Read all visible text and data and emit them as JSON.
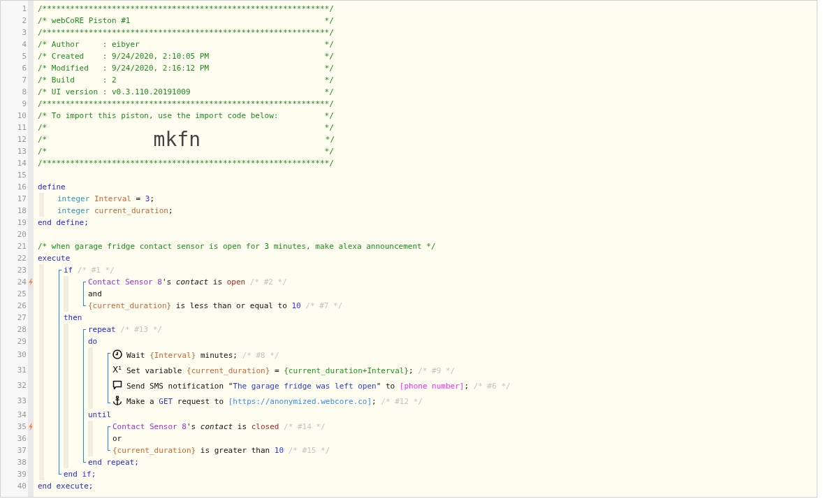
{
  "editor": {
    "lines": [
      {
        "kind": "line",
        "number": "1",
        "trigger": false,
        "tokens": [
          {
            "kind": "comment",
            "text": "/**************************************************************/"
          }
        ]
      },
      {
        "kind": "line",
        "number": "2",
        "trigger": false,
        "tokens": [
          {
            "kind": "comment",
            "text": "/* webCoRE Piston #1                                          */"
          }
        ]
      },
      {
        "kind": "line",
        "number": "3",
        "trigger": false,
        "tokens": [
          {
            "kind": "comment",
            "text": "/**************************************************************/"
          }
        ]
      },
      {
        "kind": "line",
        "number": "4",
        "trigger": false,
        "tokens": [
          {
            "kind": "comment",
            "text": "/* Author     : eibyer                                        */"
          }
        ]
      },
      {
        "kind": "line",
        "number": "5",
        "trigger": false,
        "tokens": [
          {
            "kind": "comment",
            "text": "/* Created    : 9/24/2020, 2:10:05 PM                         */"
          }
        ]
      },
      {
        "kind": "line",
        "number": "6",
        "trigger": false,
        "tokens": [
          {
            "kind": "comment",
            "text": "/* Modified   : 9/24/2020, 2:16:12 PM                         */"
          }
        ]
      },
      {
        "kind": "line",
        "number": "7",
        "trigger": false,
        "tokens": [
          {
            "kind": "comment",
            "text": "/* Build      : 2                                             */"
          }
        ]
      },
      {
        "kind": "line",
        "number": "8",
        "trigger": false,
        "tokens": [
          {
            "kind": "comment",
            "text": "/* UI version : v0.3.110.20191009                             */"
          }
        ]
      },
      {
        "kind": "line",
        "number": "9",
        "trigger": false,
        "tokens": [
          {
            "kind": "comment",
            "text": "/**************************************************************/"
          }
        ]
      },
      {
        "kind": "line",
        "number": "10",
        "trigger": false,
        "tokens": [
          {
            "kind": "comment",
            "text": "/* To import this piston, use the import code below:          */"
          }
        ]
      },
      {
        "kind": "line",
        "number": "11",
        "trigger": false,
        "tokens": [
          {
            "kind": "comment",
            "text": "/*                                                            */"
          }
        ]
      },
      {
        "kind": "line",
        "number": "12",
        "trigger": false,
        "tokens": [
          {
            "kind": "comment",
            "text": "/*                       "
          },
          {
            "kind": "import_code",
            "text": "mkfn"
          },
          {
            "kind": "comment",
            "text": "                           */"
          }
        ]
      },
      {
        "kind": "line",
        "number": "13",
        "trigger": false,
        "tokens": [
          {
            "kind": "comment",
            "text": "/*                                                            */"
          }
        ]
      },
      {
        "kind": "line",
        "number": "14",
        "trigger": false,
        "tokens": [
          {
            "kind": "comment",
            "text": "/**************************************************************/"
          }
        ]
      },
      {
        "kind": "line",
        "number": "15",
        "trigger": false
      },
      {
        "kind": "line",
        "number": "16",
        "trigger": false,
        "tokens": [
          {
            "kind": "keyword",
            "text": "define"
          }
        ]
      },
      {
        "kind": "block",
        "bracket": false,
        "children": [
          {
            "kind": "line",
            "number": "17",
            "trigger": false,
            "tokens": [
              {
                "kind": "type",
                "text": "integer"
              },
              {
                "kind": "variable",
                "text": " Interval"
              },
              {
                "kind": "plain",
                "text": " = "
              },
              {
                "kind": "number",
                "text": "3"
              },
              {
                "kind": "plain",
                "text": ";"
              }
            ]
          },
          {
            "kind": "line",
            "number": "18",
            "trigger": false,
            "tokens": [
              {
                "kind": "type",
                "text": "integer"
              },
              {
                "kind": "variable",
                "text": " current_duration"
              },
              {
                "kind": "plain",
                "text": ";"
              }
            ]
          }
        ]
      },
      {
        "kind": "line",
        "number": "19",
        "trigger": false,
        "tokens": [
          {
            "kind": "keyword",
            "text": "end define;"
          }
        ]
      },
      {
        "kind": "line",
        "number": "20",
        "trigger": false
      },
      {
        "kind": "line",
        "number": "21",
        "trigger": false,
        "tokens": [
          {
            "kind": "comment",
            "text": "/* when garage fridge contact sensor is open for 3 minutes, make alexa announcement */"
          }
        ]
      },
      {
        "kind": "line",
        "number": "22",
        "trigger": false,
        "tokens": [
          {
            "kind": "keyword",
            "text": "execute"
          }
        ]
      },
      {
        "kind": "block",
        "bracket": true,
        "children": [
          {
            "kind": "line",
            "number": "23",
            "trigger": false,
            "tokens": [
              {
                "kind": "keyword",
                "text": "if"
              },
              {
                "kind": "note",
                "text": " /* #1 */"
              }
            ]
          },
          {
            "kind": "block",
            "bracket": true,
            "children": [
              {
                "kind": "line",
                "number": "24",
                "trigger": true,
                "tokens": [
                  {
                    "kind": "device",
                    "text": "Contact Sensor 8"
                  },
                  {
                    "kind": "plain",
                    "text": "'s "
                  },
                  {
                    "kind": "attribute",
                    "text": "contact"
                  },
                  {
                    "kind": "plain",
                    "text": " is "
                  },
                  {
                    "kind": "value",
                    "text": "open"
                  },
                  {
                    "kind": "note",
                    "text": " /* #2 */"
                  }
                ]
              },
              {
                "kind": "line",
                "number": "25",
                "trigger": false,
                "tokens": [
                  {
                    "kind": "plain",
                    "text": "and"
                  }
                ]
              },
              {
                "kind": "line",
                "number": "26",
                "trigger": false,
                "tokens": [
                  {
                    "kind": "variable",
                    "text": "{current_duration}"
                  },
                  {
                    "kind": "plain",
                    "text": " is less than or equal to "
                  },
                  {
                    "kind": "number",
                    "text": "10"
                  },
                  {
                    "kind": "note",
                    "text": " /* #7 */"
                  }
                ]
              }
            ]
          },
          {
            "kind": "line",
            "number": "27",
            "trigger": false,
            "tokens": [
              {
                "kind": "keyword",
                "text": "then"
              }
            ]
          },
          {
            "kind": "block",
            "bracket": true,
            "children": [
              {
                "kind": "line",
                "number": "28",
                "trigger": false,
                "tokens": [
                  {
                    "kind": "keyword",
                    "text": "repeat"
                  },
                  {
                    "kind": "note",
                    "text": " /* #13 */"
                  }
                ]
              },
              {
                "kind": "line",
                "number": "29",
                "trigger": false,
                "tokens": [
                  {
                    "kind": "keyword",
                    "text": "do"
                  }
                ]
              },
              {
                "kind": "block",
                "bracket": true,
                "children": [
                  {
                    "kind": "wait",
                    "number": "30",
                    "trigger": false,
                    "tokens": [
                      {
                        "kind": "plain",
                        "text": "Wait "
                      },
                      {
                        "kind": "variable",
                        "text": "{Interval}"
                      },
                      {
                        "kind": "plain",
                        "text": " minutes; "
                      },
                      {
                        "kind": "note",
                        "text": "/* #8 */"
                      }
                    ]
                  },
                  {
                    "kind": "set_variable",
                    "number": "31",
                    "trigger": false,
                    "symbol": "X¹",
                    "tokens": [
                      {
                        "kind": "plain",
                        "text": "Set variable "
                      },
                      {
                        "kind": "variable",
                        "text": "{current_duration}"
                      },
                      {
                        "kind": "plain",
                        "text": " = "
                      },
                      {
                        "kind": "expression",
                        "text": "{current_duration+Interval}"
                      },
                      {
                        "kind": "plain",
                        "text": "; "
                      },
                      {
                        "kind": "note",
                        "text": "/* #9 */"
                      }
                    ]
                  },
                  {
                    "kind": "notification",
                    "number": "32",
                    "trigger": false,
                    "tokens": [
                      {
                        "kind": "plain",
                        "text": "Send SMS notification \""
                      },
                      {
                        "kind": "string",
                        "text": "The garage fridge was left open"
                      },
                      {
                        "kind": "plain",
                        "text": "\" to "
                      },
                      {
                        "kind": "device_variable",
                        "text": "[phone number]"
                      },
                      {
                        "kind": "plain",
                        "text": "; "
                      },
                      {
                        "kind": "note",
                        "text": "/* #6 */"
                      }
                    ]
                  },
                  {
                    "kind": "http_request",
                    "number": "33",
                    "trigger": false,
                    "tokens": [
                      {
                        "kind": "plain",
                        "text": "Make a "
                      },
                      {
                        "kind": "method",
                        "text": "GET"
                      },
                      {
                        "kind": "plain",
                        "text": " request to "
                      },
                      {
                        "kind": "url",
                        "text": "[https://anonymized.webcore.co]"
                      },
                      {
                        "kind": "plain",
                        "text": "; "
                      },
                      {
                        "kind": "note",
                        "text": "/* #12 */"
                      }
                    ]
                  }
                ]
              },
              {
                "kind": "line",
                "number": "34",
                "trigger": false,
                "tokens": [
                  {
                    "kind": "keyword",
                    "text": "until"
                  }
                ]
              },
              {
                "kind": "block",
                "bracket": true,
                "children": [
                  {
                    "kind": "line",
                    "number": "35",
                    "trigger": true,
                    "tokens": [
                      {
                        "kind": "device",
                        "text": "Contact Sensor 8"
                      },
                      {
                        "kind": "plain",
                        "text": "'s "
                      },
                      {
                        "kind": "attribute",
                        "text": "contact"
                      },
                      {
                        "kind": "plain",
                        "text": " is "
                      },
                      {
                        "kind": "value",
                        "text": "closed"
                      },
                      {
                        "kind": "note",
                        "text": " /* #14 */"
                      }
                    ]
                  },
                  {
                    "kind": "line",
                    "number": "36",
                    "trigger": false,
                    "tokens": [
                      {
                        "kind": "plain",
                        "text": "or"
                      }
                    ]
                  },
                  {
                    "kind": "line",
                    "number": "37",
                    "trigger": false,
                    "tokens": [
                      {
                        "kind": "variable",
                        "text": "{current_duration}"
                      },
                      {
                        "kind": "plain",
                        "text": " is greater than "
                      },
                      {
                        "kind": "number",
                        "text": "10"
                      },
                      {
                        "kind": "note",
                        "text": " /* #15 */"
                      }
                    ]
                  }
                ]
              },
              {
                "kind": "line",
                "number": "38",
                "trigger": false,
                "tokens": [
                  {
                    "kind": "keyword",
                    "text": "end repeat;"
                  }
                ]
              }
            ]
          },
          {
            "kind": "line",
            "number": "39",
            "trigger": false,
            "tokens": [
              {
                "kind": "keyword",
                "text": "end if;"
              }
            ]
          }
        ]
      },
      {
        "kind": "line",
        "number": "40",
        "trigger": false,
        "tokens": [
          {
            "kind": "keyword",
            "text": "end execute;"
          }
        ]
      }
    ]
  }
}
